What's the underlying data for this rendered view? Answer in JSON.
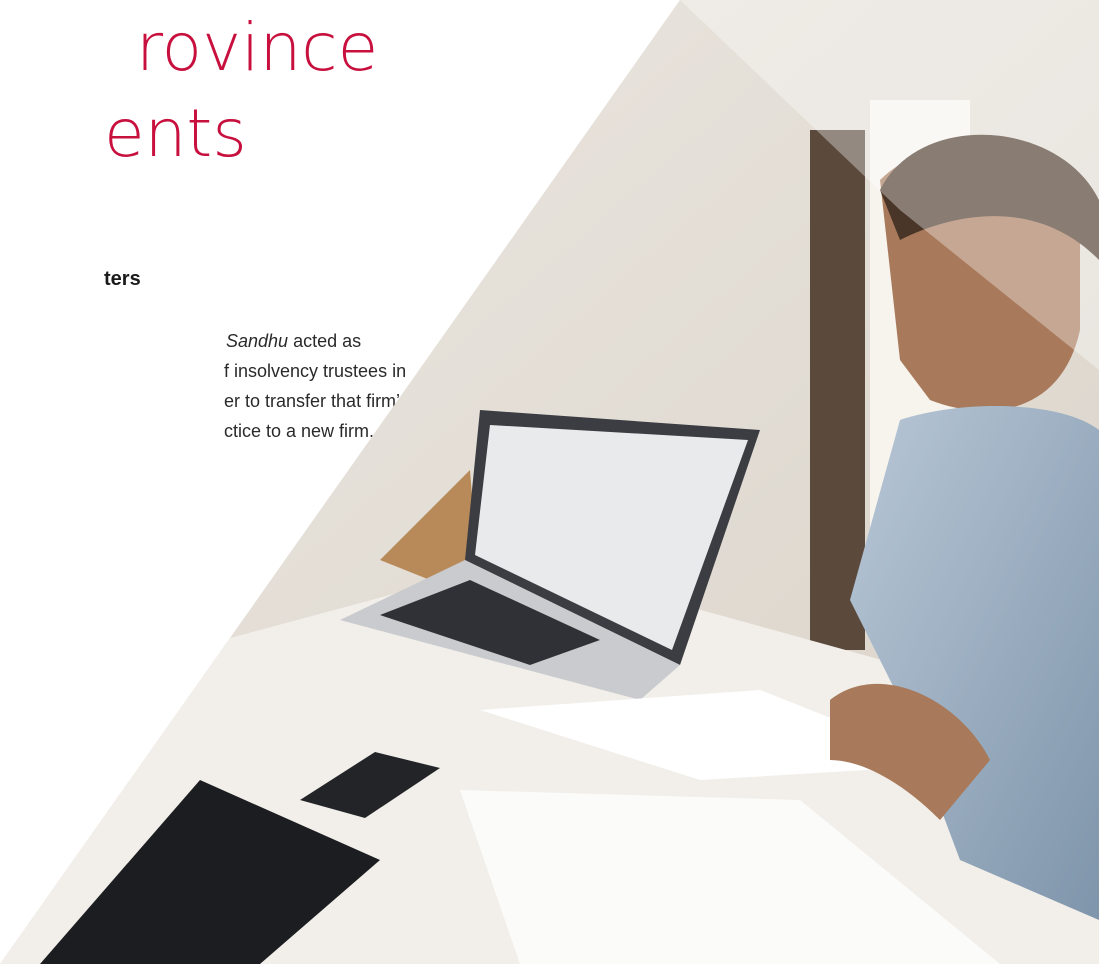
{
  "heading": {
    "line1": "rovince",
    "line2": "ents"
  },
  "subheading": "ters",
  "paragraph": {
    "line1_italic": "Sandhu",
    "line1_rest": " acted as",
    "line2": "f insolvency trustees in",
    "line3": "er to transfer that firm’s",
    "line4": "ctice to a new firm."
  },
  "photo": {
    "description_icon": "office-photo",
    "accent_color": "#c8103e"
  }
}
